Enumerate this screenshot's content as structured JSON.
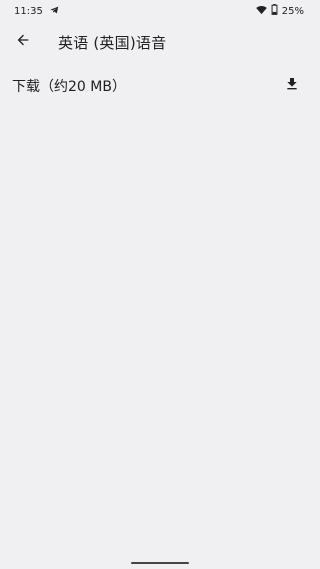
{
  "status_bar": {
    "time": "11:35",
    "battery": "25%"
  },
  "header": {
    "title": "英语 (英国)语音"
  },
  "download_row": {
    "label": "下载（约20 MB）"
  },
  "icons": {
    "back": "arrow-back-icon",
    "download": "download-icon",
    "notification": "telegram-icon",
    "wifi": "wifi-icon",
    "battery": "battery-icon"
  }
}
